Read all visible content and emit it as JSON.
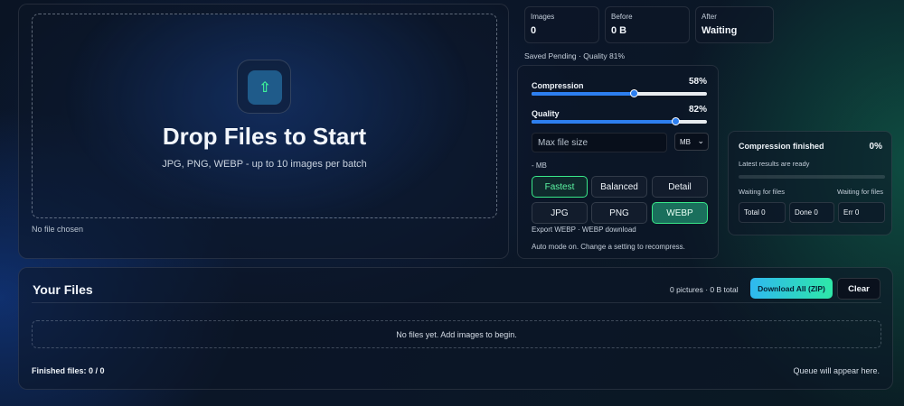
{
  "upload": {
    "title": "Drop Files to Start",
    "subtitle": "JPG, PNG, WEBP - up to 10 images per batch",
    "file_status": "No file chosen",
    "icon": "upload-arrow-icon"
  },
  "stats": {
    "images": {
      "label": "Images",
      "value": "0"
    },
    "before": {
      "label": "Before",
      "value": "0 B"
    },
    "after": {
      "label": "After",
      "value": "Waiting"
    },
    "saved_line": "Saved Pending · Quality 81%"
  },
  "settings": {
    "compression": {
      "label": "Compression",
      "value_text": "58%",
      "value": 58
    },
    "quality": {
      "label": "Quality",
      "value_text": "82%",
      "value": 82
    },
    "max_size_placeholder": "Max file size",
    "unit_selected": "MB",
    "mb_note": "- MB",
    "modes": [
      "Fastest",
      "Balanced",
      "Detail"
    ],
    "active_mode": "Fastest",
    "formats": [
      "JPG",
      "PNG",
      "WEBP"
    ],
    "active_format": "WEBP",
    "export_note": "Export WEBP · WEBP download",
    "auto_note": "Auto mode on. Change a setting to recompress."
  },
  "progress": {
    "title": "Compression finished",
    "percent_text": "0%",
    "percent": 0,
    "subtitle": "Latest results are ready",
    "waiting_left": "Waiting for files",
    "waiting_right": "Waiting for files",
    "total": "Total 0",
    "done": "Done 0",
    "err": "Err 0"
  },
  "files": {
    "title": "Your Files",
    "count_text": "0 pictures · 0 B total",
    "download_label": "Download All (ZIP)",
    "clear_label": "Clear",
    "empty_text": "No files yet. Add images to begin.",
    "finished_label": "Finished files: 0 / 0",
    "queue_note": "Queue will appear here."
  },
  "colors": {
    "accent_blue": "#2d7ff0",
    "accent_green": "#3ef09a"
  }
}
